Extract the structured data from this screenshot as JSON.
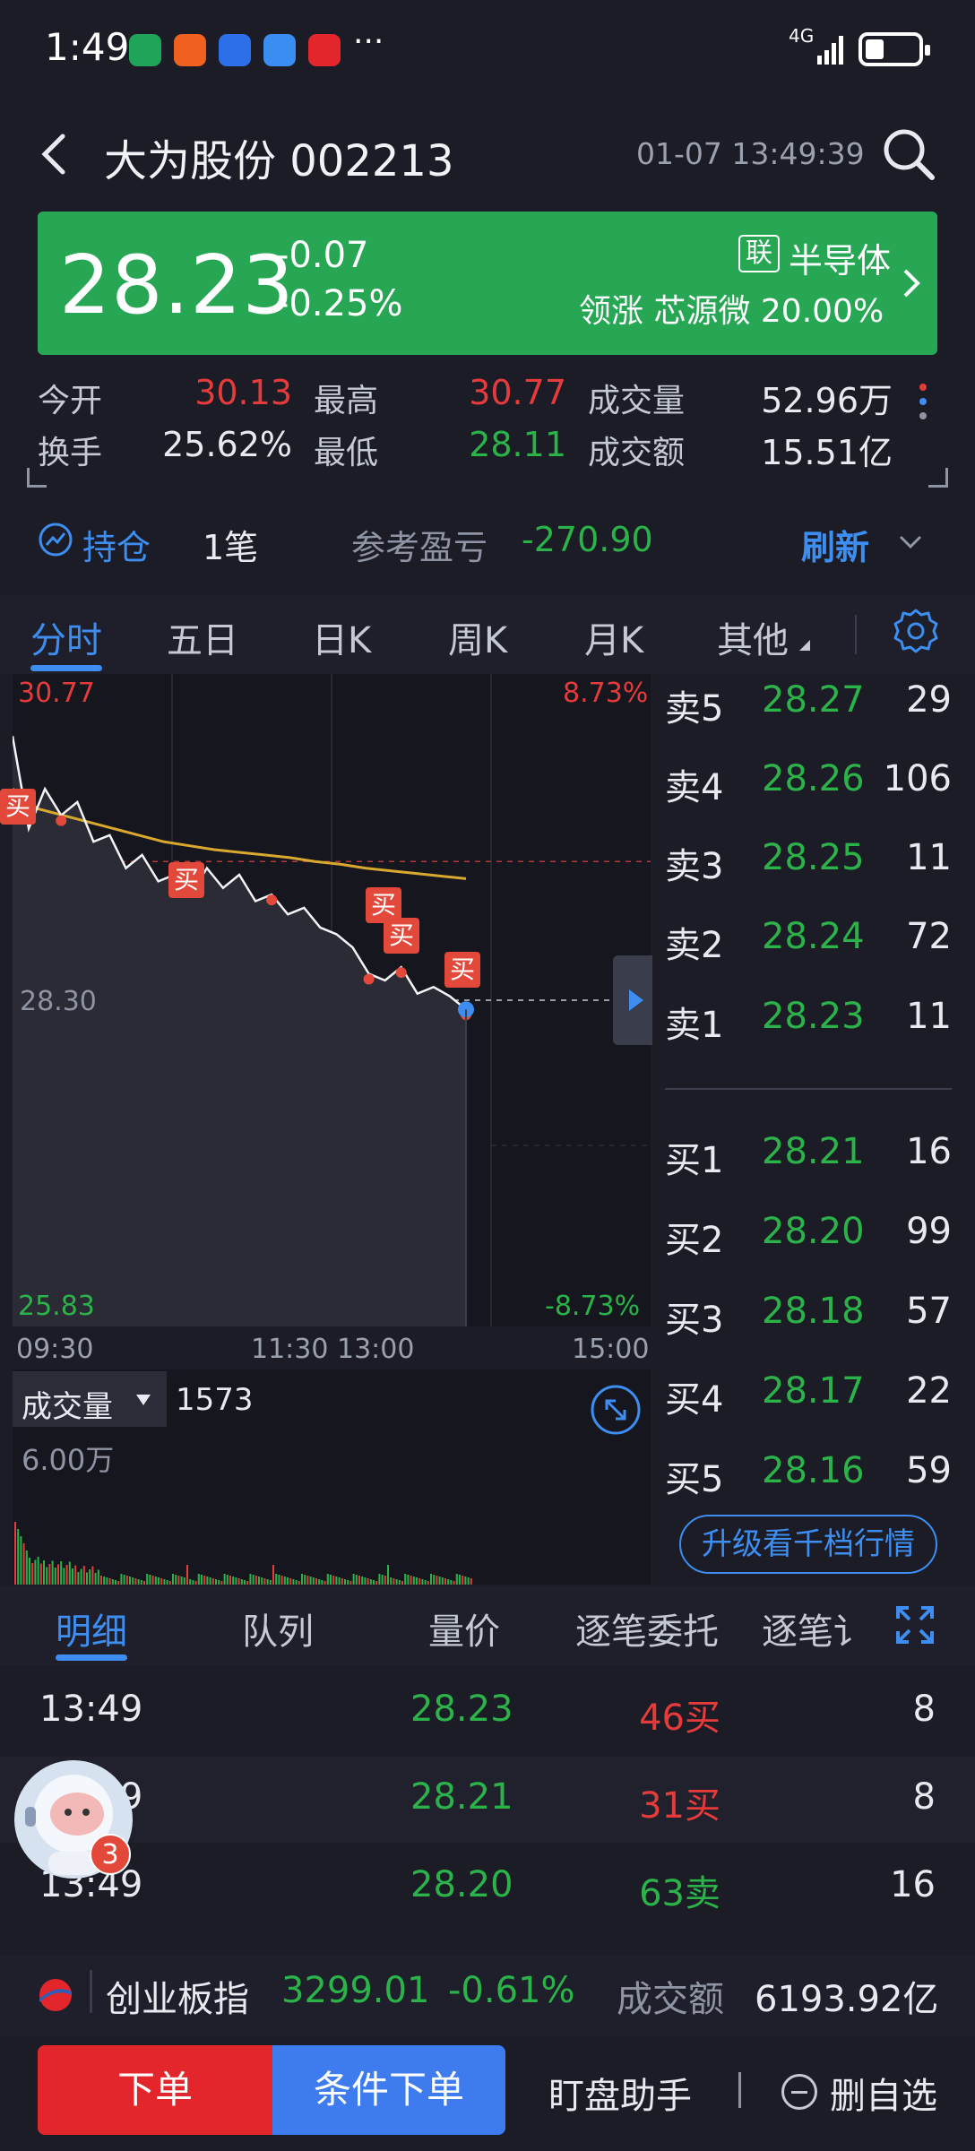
{
  "status_bar": {
    "time": "1:49",
    "more": "···",
    "network": "4G"
  },
  "header": {
    "title": "大为股份 002213",
    "datetime": "01-07 13:49:39"
  },
  "banner": {
    "price": "28.23",
    "change": "-0.07",
    "change_pct": "-0.25%",
    "badge": "联",
    "sector": "半导体",
    "leading": "领涨 芯源微 20.00%",
    "color": "#27a654"
  },
  "stats": {
    "open_label": "今开",
    "open": "30.13",
    "high_label": "最高",
    "high": "30.77",
    "volume_label": "成交量",
    "volume": "52.96万",
    "turnover_label": "换手",
    "turnover": "25.62%",
    "low_label": "最低",
    "low": "28.11",
    "amount_label": "成交额",
    "amount": "15.51亿"
  },
  "position": {
    "label": "持仓",
    "count": "1笔",
    "pnl_label": "参考盈亏",
    "pnl": "-270.90",
    "refresh": "刷新"
  },
  "chart_tabs": [
    "分时",
    "五日",
    "日K",
    "周K",
    "月K",
    "其他"
  ],
  "chart": {
    "y_top": "30.77",
    "y_top_pct": "8.73%",
    "y_bottom": "25.83",
    "y_bottom_pct": "-8.73%",
    "prev_close": "28.30",
    "times": [
      "09:30",
      "11:30 13:00",
      "15:00"
    ],
    "buy_tag": "买"
  },
  "chart_data": {
    "type": "line",
    "ylim": [
      25.83,
      30.77
    ],
    "series": [
      {
        "values": [
          30.3,
          29.6,
          29.9,
          29.7,
          29.8,
          29.5,
          29.55,
          29.3,
          29.4,
          29.2,
          29.25,
          29.1,
          29.3,
          29.15,
          29.25,
          29.05,
          29.1,
          28.95,
          29.0,
          28.85,
          28.8,
          28.7,
          28.5,
          28.45,
          28.55,
          28.35,
          28.4,
          28.33,
          28.23
        ]
      },
      {
        "values": [
          29.9,
          29.75,
          29.7,
          29.65,
          29.6,
          29.55,
          29.5,
          29.47,
          29.44,
          29.42,
          29.4,
          29.38,
          29.35,
          29.33,
          29.3,
          29.28,
          29.26,
          29.24,
          29.22
        ]
      }
    ]
  },
  "volume": {
    "label": "成交量",
    "value": "1573",
    "scale": "6.00万"
  },
  "order_book": {
    "asks": [
      {
        "label": "卖5",
        "price": "28.27",
        "vol": "29"
      },
      {
        "label": "卖4",
        "price": "28.26",
        "vol": "106"
      },
      {
        "label": "卖3",
        "price": "28.25",
        "vol": "11"
      },
      {
        "label": "卖2",
        "price": "28.24",
        "vol": "72"
      },
      {
        "label": "卖1",
        "price": "28.23",
        "vol": "11"
      }
    ],
    "bids": [
      {
        "label": "买1",
        "price": "28.21",
        "vol": "16"
      },
      {
        "label": "买2",
        "price": "28.20",
        "vol": "99"
      },
      {
        "label": "买3",
        "price": "28.18",
        "vol": "57"
      },
      {
        "label": "买4",
        "price": "28.17",
        "vol": "22"
      },
      {
        "label": "买5",
        "price": "28.16",
        "vol": "59"
      }
    ],
    "upgrade": "升级看千档行情"
  },
  "detail_tabs": [
    "明细",
    "队列",
    "量价",
    "逐笔委托",
    "逐笔讠"
  ],
  "trades": [
    {
      "time": "13:49",
      "price": "28.23",
      "vol": "46买",
      "count": "8"
    },
    {
      "time": "13:49",
      "price": "28.21",
      "vol": "31买",
      "count": "8"
    },
    {
      "time": "13:49",
      "price": "28.20",
      "vol": "63卖",
      "count": "16"
    }
  ],
  "assistant": {
    "badge": "3"
  },
  "index": {
    "name": "创业板指",
    "value": "3299.01",
    "pct": "-0.61%",
    "amount_label": "成交额",
    "amount": "6193.92亿"
  },
  "bottom": {
    "order": "下单",
    "conditional": "条件下单",
    "assistant": "盯盘助手",
    "remove": "删自选"
  }
}
